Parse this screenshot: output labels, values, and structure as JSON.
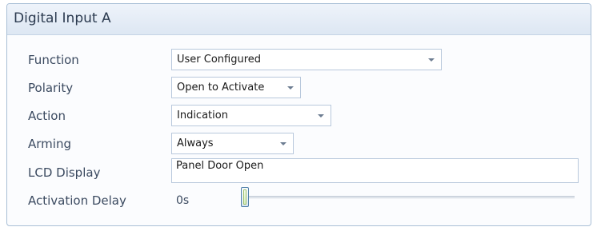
{
  "panel": {
    "title": "Digital Input A"
  },
  "fields": {
    "function": {
      "label": "Function",
      "value": "User Configured"
    },
    "polarity": {
      "label": "Polarity",
      "value": "Open to Activate"
    },
    "action": {
      "label": "Action",
      "value": "Indication"
    },
    "arming": {
      "label": "Arming",
      "value": "Always"
    },
    "lcd_display": {
      "label": "LCD Display",
      "value": "Panel Door Open"
    },
    "activation_delay": {
      "label": "Activation Delay",
      "value": "0s",
      "slider_fraction": 0
    }
  },
  "icons": {
    "dropdown": "chevron-down-icon"
  },
  "colors": {
    "header_bg": "#dde7f3",
    "border": "#a9bfd6",
    "label_text": "#3b4a60",
    "slider_thumb_accent": "#9fc16a"
  }
}
